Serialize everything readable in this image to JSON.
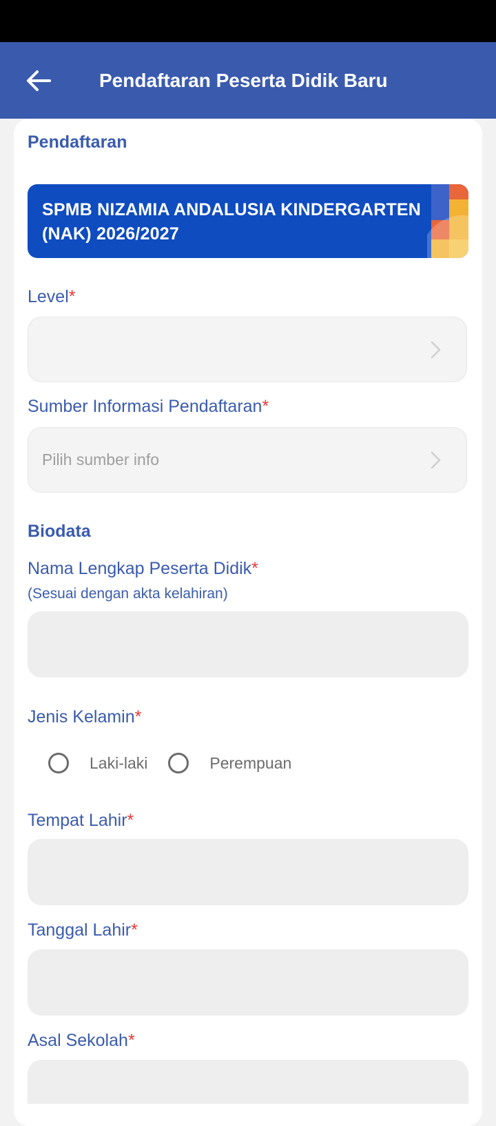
{
  "app_bar": {
    "title": "Pendaftaran Peserta Didik Baru",
    "back_icon": "arrow-left-icon",
    "background_color": "#3a5bad"
  },
  "sections": {
    "registration_title": "Pendaftaran",
    "biodata_title": "Biodata"
  },
  "banner": {
    "text": "SPMB NIZAMIA ANDALUSIA KINDERGARTEN (NAK) 2026/2027",
    "background_color": "#0e4cc0"
  },
  "fields": {
    "level": {
      "label": "Level",
      "required_mark": "*",
      "value": ""
    },
    "info_source": {
      "label": "Sumber Informasi Pendaftaran",
      "required_mark": "*",
      "placeholder": "Pilih sumber info"
    },
    "full_name": {
      "label": "Nama Lengkap Peserta Didik",
      "required_mark": "*",
      "hint": "(Sesuai dengan akta kelahiran)",
      "value": ""
    },
    "gender": {
      "label": "Jenis Kelamin",
      "required_mark": "*",
      "options": [
        "Laki-laki",
        "Perempuan"
      ],
      "selected": null
    },
    "birth_place": {
      "label": "Tempat Lahir",
      "required_mark": "*",
      "value": ""
    },
    "birth_date": {
      "label": "Tanggal Lahir",
      "required_mark": "*",
      "value": ""
    },
    "origin_school": {
      "label": "Asal Sekolah",
      "required_mark": "*",
      "value": ""
    }
  },
  "colors": {
    "accent": "#3a5bad",
    "required": "#e53935",
    "field_background": "#eeeeee"
  }
}
